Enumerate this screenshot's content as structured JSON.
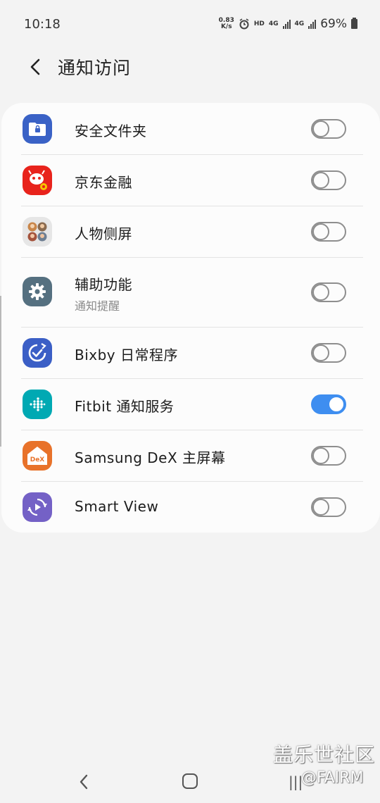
{
  "status_bar": {
    "time": "10:18",
    "net_speed_value": "0.83",
    "net_speed_unit": "K/s",
    "hd_label": "HD",
    "network_label_1": "4G",
    "network_label_2": "4G",
    "battery_text": "69%",
    "alarm_icon": "alarm-clock-icon",
    "battery_icon": "battery-icon"
  },
  "header": {
    "title": "通知访问",
    "back_icon": "back-arrow-icon"
  },
  "apps": [
    {
      "name": "安全文件夹",
      "subtitle": "",
      "enabled": false,
      "icon": "secure-folder-icon",
      "icon_color": "#3a62c6"
    },
    {
      "name": "京东金融",
      "subtitle": "",
      "enabled": false,
      "icon": "jd-finance-icon",
      "icon_color": "#e8231c"
    },
    {
      "name": "人物侧屏",
      "subtitle": "",
      "enabled": false,
      "icon": "people-edge-icon",
      "icon_color": "#e6e6e6"
    },
    {
      "name": "辅助功能",
      "subtitle": "通知提醒",
      "enabled": false,
      "icon": "gear-icon",
      "icon_color": "#557080"
    },
    {
      "name": "Bixby 日常程序",
      "subtitle": "",
      "enabled": false,
      "icon": "bixby-routines-icon",
      "icon_color": "#3b5fc6"
    },
    {
      "name": "Fitbit 通知服务",
      "subtitle": "",
      "enabled": true,
      "icon": "fitbit-icon",
      "icon_color": "#00a9b3"
    },
    {
      "name": "Samsung DeX 主屏幕",
      "subtitle": "",
      "enabled": false,
      "icon": "dex-icon",
      "icon_color": "#e8722a",
      "icon_text": "DeX"
    },
    {
      "name": "Smart View",
      "subtitle": "",
      "enabled": false,
      "icon": "smart-view-icon",
      "icon_color": "#7461c6"
    }
  ],
  "colors": {
    "toggle_on": "#3e8ef0",
    "toggle_off": "#8e8e8e",
    "background": "#f3f3f3",
    "card": "#fcfcfc"
  },
  "nav_bar": {
    "back_icon": "nav-back-icon",
    "home_icon": "nav-home-icon",
    "recent_icon": "nav-recent-apps-icon"
  },
  "watermark": {
    "line1": "盖乐世社区",
    "line2": "@FAIRM"
  }
}
